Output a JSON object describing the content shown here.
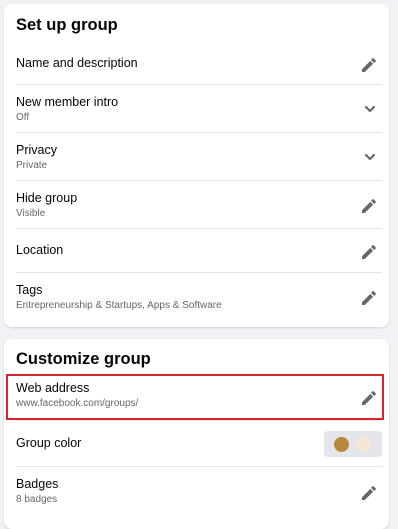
{
  "setup": {
    "title": "Set up group",
    "rows": [
      {
        "label": "Name and description",
        "sub": "",
        "action": "pencil-icon"
      },
      {
        "label": "New member intro",
        "sub": "Off",
        "action": "chevron-down-icon"
      },
      {
        "label": "Privacy",
        "sub": "Private",
        "action": "chevron-down-icon"
      },
      {
        "label": "Hide group",
        "sub": "Visible",
        "action": "pencil-icon"
      },
      {
        "label": "Location",
        "sub": "",
        "action": "pencil-icon"
      },
      {
        "label": "Tags",
        "sub": "Entrepreneurship & Startups, Apps & Software",
        "action": "pencil-icon"
      }
    ]
  },
  "customize": {
    "title": "Customize group",
    "web_address": {
      "label": "Web address",
      "sub": "www.facebook.com/groups/",
      "action": "pencil-icon"
    },
    "group_color": {
      "label": "Group color",
      "colors": [
        "#b5883b",
        "#f5e6d3"
      ]
    },
    "badges": {
      "label": "Badges",
      "sub": "8 badges",
      "action": "pencil-icon"
    }
  },
  "colors": {
    "highlight_border": "#d8262c",
    "icon": "#65676b",
    "secondary_text": "#65676b",
    "background": "#f0f2f5"
  }
}
